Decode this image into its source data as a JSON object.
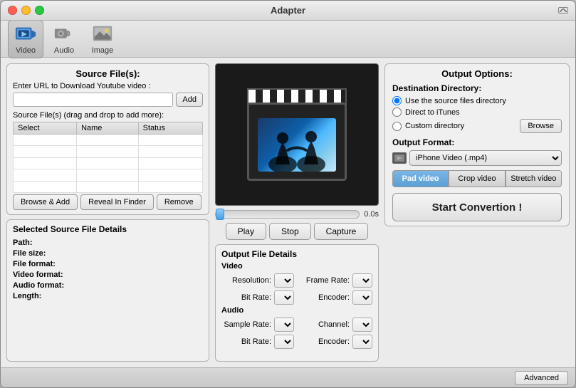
{
  "window": {
    "title": "Adapter"
  },
  "toolbar": {
    "items": [
      {
        "id": "video",
        "label": "Video",
        "active": true
      },
      {
        "id": "audio",
        "label": "Audio",
        "active": false
      },
      {
        "id": "image",
        "label": "Image",
        "active": false
      }
    ]
  },
  "source": {
    "section_title": "Source File(s):",
    "url_label": "Enter URL to Download Youtube video :",
    "add_btn": "Add",
    "drag_label": "Source File(s) (drag and drop to add more):",
    "table_headers": [
      "Select",
      "Name",
      "Status"
    ],
    "browse_add_btn": "Browse & Add",
    "reveal_btn": "Reveal In Finder",
    "remove_btn": "Remove"
  },
  "details": {
    "title": "Selected Source File Details",
    "fields": [
      {
        "label": "Path:",
        "value": ""
      },
      {
        "label": "File size:",
        "value": ""
      },
      {
        "label": "File format:",
        "value": ""
      },
      {
        "label": "Video format:",
        "value": ""
      },
      {
        "label": "Audio format:",
        "value": ""
      },
      {
        "label": "Length:",
        "value": ""
      }
    ]
  },
  "output_options": {
    "title": "Output Options:",
    "dest_label": "Destination Directory:",
    "radio_options": [
      {
        "id": "source",
        "label": "Use the source files directory",
        "checked": true
      },
      {
        "id": "itunes",
        "label": "Direct to iTunes",
        "checked": false
      },
      {
        "id": "custom",
        "label": "Custom directory",
        "checked": false
      }
    ],
    "browse_btn": "Browse",
    "format_label": "Output Format:",
    "format_value": "iPhone Video (.mp4)",
    "mode_buttons": [
      {
        "id": "pad",
        "label": "Pad video",
        "active": true
      },
      {
        "id": "crop",
        "label": "Crop video",
        "active": false
      },
      {
        "id": "stretch",
        "label": "Stretch video",
        "active": false
      }
    ],
    "start_btn": "Start Convertion !"
  },
  "output_details": {
    "title": "Output File Details",
    "video_section": "Video",
    "audio_section": "Audio",
    "video_fields": [
      {
        "label": "Resolution:",
        "value": ""
      },
      {
        "label": "Frame Rate:",
        "value": ""
      },
      {
        "label": "Bit Rate:",
        "value": ""
      },
      {
        "label": "Encoder:",
        "value": ""
      }
    ],
    "audio_fields": [
      {
        "label": "Sample Rate:",
        "value": ""
      },
      {
        "label": "Channel:",
        "value": ""
      },
      {
        "label": "Bit Rate:",
        "value": ""
      },
      {
        "label": "Encoder:",
        "value": ""
      }
    ]
  },
  "player": {
    "time": "0.0s",
    "play_btn": "Play",
    "stop_btn": "Stop",
    "capture_btn": "Capture"
  },
  "bottom": {
    "advanced_btn": "Advanced"
  }
}
